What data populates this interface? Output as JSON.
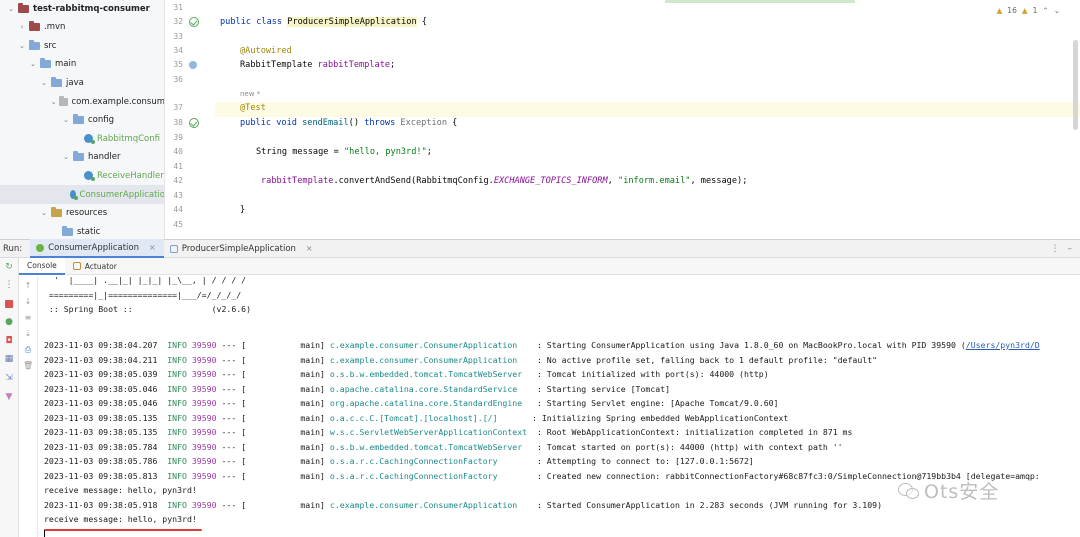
{
  "project_tree": [
    {
      "label": "test-rabbitmq-consumer",
      "depth": 0,
      "chev": "open",
      "icon": "maroon",
      "bold": true
    },
    {
      "label": ".mvn",
      "depth": 1,
      "chev": "closed",
      "icon": "maroon"
    },
    {
      "label": "src",
      "depth": 1,
      "chev": "open",
      "icon": "src"
    },
    {
      "label": "main",
      "depth": 2,
      "chev": "open",
      "icon": "src"
    },
    {
      "label": "java",
      "depth": 3,
      "chev": "open",
      "icon": "blue"
    },
    {
      "label": "com.example.consum",
      "depth": 4,
      "chev": "open",
      "icon": "pkg"
    },
    {
      "label": "config",
      "depth": 5,
      "chev": "open",
      "icon": "blue"
    },
    {
      "label": "RabbitmqConfi",
      "depth": 6,
      "chev": "none",
      "icon": "class",
      "green": true
    },
    {
      "label": "handler",
      "depth": 5,
      "chev": "open",
      "icon": "blue"
    },
    {
      "label": "ReceiveHandler",
      "depth": 6,
      "chev": "none",
      "icon": "class",
      "green": true
    },
    {
      "label": "ConsumerApplicatio",
      "depth": 5,
      "chev": "none",
      "icon": "class",
      "green": true,
      "selected": true
    },
    {
      "label": "resources",
      "depth": 3,
      "chev": "open",
      "icon": "res"
    },
    {
      "label": "static",
      "depth": 4,
      "chev": "none",
      "icon": "blue"
    }
  ],
  "editor": {
    "line_numbers": [
      "31",
      "32",
      "33",
      "34",
      "35",
      "36",
      "37",
      "38",
      "39",
      "40",
      "41",
      "42",
      "43",
      "44",
      "45"
    ],
    "usage_hint": "new *",
    "warnings": "16",
    "weak_warnings": "1",
    "code": {
      "public_class": "public class ",
      "class_name": "ProducerSimpleApplication",
      "brace_open": " {",
      "autowired": "@Autowired",
      "field_type": "RabbitTemplate ",
      "field_name": "rabbitTemplate",
      "semicolon": ";",
      "test_ann": "@Test",
      "public_void": "public void ",
      "method_name": "sendEmail",
      "throws_pre": "() ",
      "throws_kw": "throws",
      "exception": " Exception",
      "method_brace": " {",
      "str_decl": "String message = ",
      "str_val": "\"hello, pyn3rd!\"",
      "str_end": ";",
      "call_obj": "rabbitTemplate",
      "call_mth": ".convertAndSend(RabbitmqConfig.",
      "call_const": "EXCHANGE_TOPICS_INFORM",
      "call_sep": ", ",
      "call_str": "\"inform.email\"",
      "call_end": ", message);",
      "brace_close": "}"
    }
  },
  "run": {
    "label": "Run:",
    "tabs": [
      {
        "label": "ConsumerApplication",
        "active": true
      },
      {
        "label": "ProducerSimpleApplication",
        "active": false
      }
    ],
    "sub_tabs": [
      {
        "label": "Console",
        "active": true
      },
      {
        "label": "Actuator",
        "active": false
      }
    ]
  },
  "console": {
    "banner": [
      "  '  |____| .__|_| |_|_| |_\\__, | / / / /",
      " =========|_|==============|___/=/_/_/_/",
      " :: Spring Boot ::                (v2.6.6)"
    ],
    "logs": [
      {
        "ts": "2023-11-03 09:38:04.207",
        "level": "INFO",
        "pid": "39590",
        "sep": " --- [",
        "thread": "           main] ",
        "logger": "c.example.consumer.ConsumerApplication   ",
        "msg": ": Starting ConsumerApplication using Java 1.8.0_60 on MacBookPro.local with PID 39590 (",
        "link": "/Users/pyn3rd/D"
      },
      {
        "ts": "2023-11-03 09:38:04.211",
        "level": "INFO",
        "pid": "39590",
        "sep": " --- [",
        "thread": "           main] ",
        "logger": "c.example.consumer.ConsumerApplication   ",
        "msg": ": No active profile set, falling back to 1 default profile: \"default\""
      },
      {
        "ts": "2023-11-03 09:38:05.039",
        "level": "INFO",
        "pid": "39590",
        "sep": " --- [",
        "thread": "           main] ",
        "logger": "o.s.b.w.embedded.tomcat.TomcatWebServer  ",
        "msg": ": Tomcat initialized with port(s): 44000 (http)"
      },
      {
        "ts": "2023-11-03 09:38:05.046",
        "level": "INFO",
        "pid": "39590",
        "sep": " --- [",
        "thread": "           main] ",
        "logger": "o.apache.catalina.core.StandardService   ",
        "msg": ": Starting service [Tomcat]"
      },
      {
        "ts": "2023-11-03 09:38:05.046",
        "level": "INFO",
        "pid": "39590",
        "sep": " --- [",
        "thread": "           main] ",
        "logger": "org.apache.catalina.core.StandardEngine  ",
        "msg": ": Starting Servlet engine: [Apache Tomcat/9.0.60]"
      },
      {
        "ts": "2023-11-03 09:38:05.135",
        "level": "INFO",
        "pid": "39590",
        "sep": " --- [",
        "thread": "           main] ",
        "logger": "o.a.c.c.C.[Tomcat].[localhost].[/]      ",
        "msg": ": Initializing Spring embedded WebApplicationContext"
      },
      {
        "ts": "2023-11-03 09:38:05.135",
        "level": "INFO",
        "pid": "39590",
        "sep": " --- [",
        "thread": "           main] ",
        "logger": "w.s.c.ServletWebServerApplicationContext ",
        "msg": ": Root WebApplicationContext: initialization completed in 871 ms"
      },
      {
        "ts": "2023-11-03 09:38:05.784",
        "level": "INFO",
        "pid": "39590",
        "sep": " --- [",
        "thread": "           main] ",
        "logger": "o.s.b.w.embedded.tomcat.TomcatWebServer  ",
        "msg": ": Tomcat started on port(s): 44000 (http) with context path ''"
      },
      {
        "ts": "2023-11-03 09:38:05.786",
        "level": "INFO",
        "pid": "39590",
        "sep": " --- [",
        "thread": "           main] ",
        "logger": "o.s.a.r.c.CachingConnectionFactory       ",
        "msg": ": Attempting to connect to: [127.0.0.1:5672]"
      },
      {
        "ts": "2023-11-03 09:38:05.813",
        "level": "INFO",
        "pid": "39590",
        "sep": " --- [",
        "thread": "           main] ",
        "logger": "o.s.a.r.c.CachingConnectionFactory       ",
        "msg": ": Created new connection: rabbitConnectionFactory#68c87fc3:0/SimpleConnection@719bb3b4 [delegate=amqp:"
      },
      {
        "plain": "receive message: hello, pyn3rd!"
      },
      {
        "ts": "2023-11-03 09:38:05.918",
        "level": "INFO",
        "pid": "39590",
        "sep": " --- [",
        "thread": "           main] ",
        "logger": "c.example.consumer.ConsumerApplication   ",
        "msg": ": Started ConsumerApplication in 2.283 seconds (JVM running for 3.109)"
      },
      {
        "plain": "receive message: hello, pyn3rd!"
      }
    ]
  },
  "watermark": "Ots安全",
  "colors": {
    "accent": "#4a83d4",
    "underline": "#e23b3b",
    "info": "#2e8b57",
    "pid": "#9b3aa6",
    "logger": "#1f8a8a"
  }
}
